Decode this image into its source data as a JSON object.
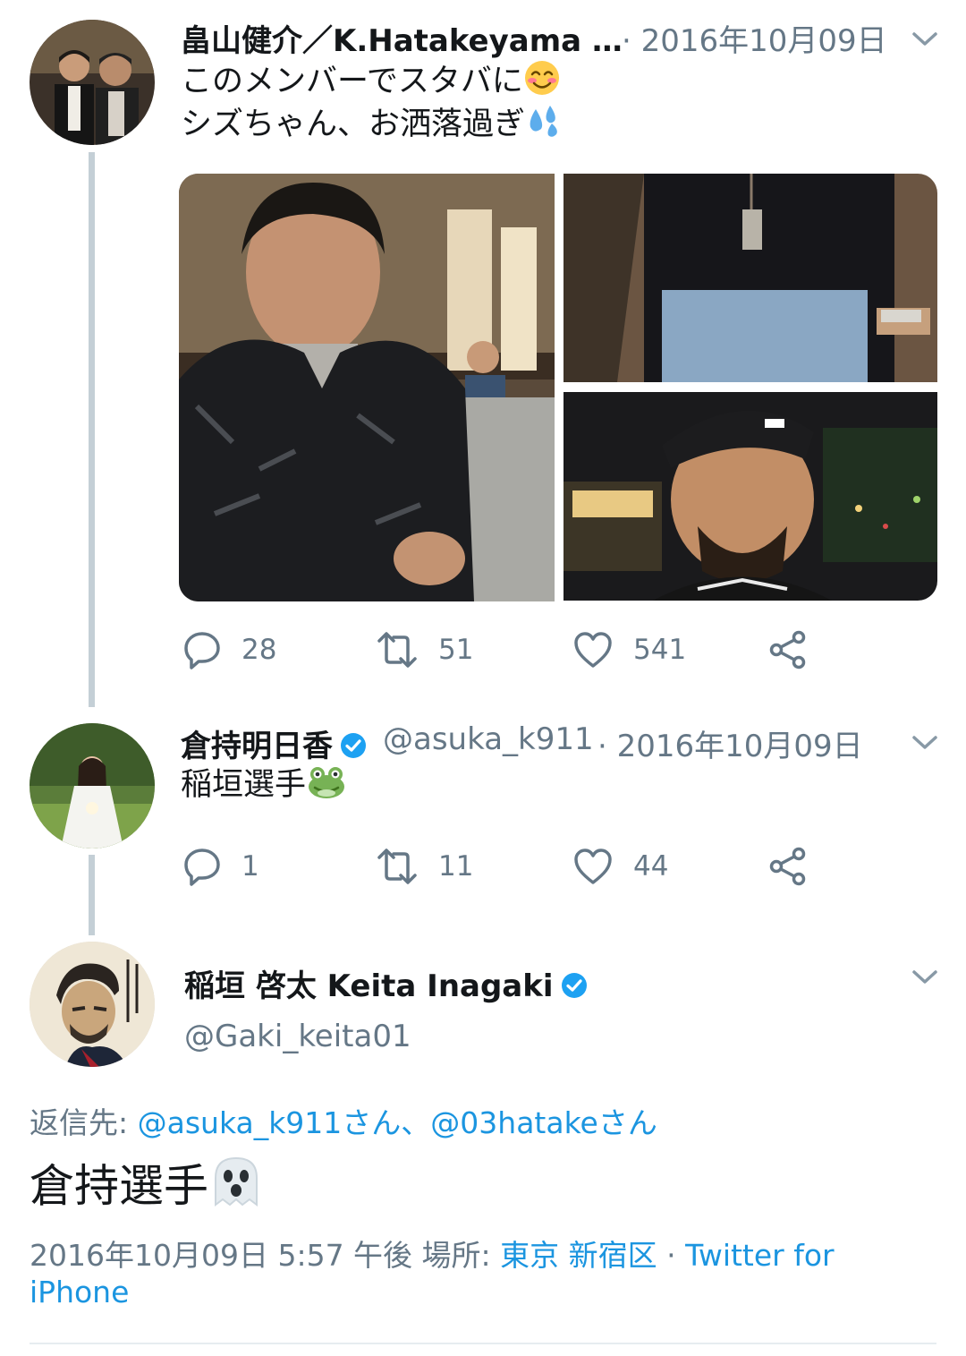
{
  "tweet1": {
    "display_name": "畠山健介／K.Hatakeyama …",
    "date": "· 2016年10月09日",
    "line1": "このメンバーでスタバに",
    "line2": "シズちゃん、お洒落過ぎ",
    "emoji1": "smiling-face-emoji",
    "emoji2": "sweat-droplets-emoji",
    "replies": "28",
    "retweets": "51",
    "likes": "541"
  },
  "tweet2": {
    "display_name": "倉持明日香",
    "handle": "@asuka_k911",
    "date": "· 2016年10月09日",
    "text": "稲垣選手",
    "emoji": "frog-emoji",
    "replies": "1",
    "retweets": "11",
    "likes": "44"
  },
  "tweet3": {
    "display_name": "稲垣 啓太 Keita Inagaki",
    "handle": "@Gaki_keita01",
    "reply_prefix": "返信先: ",
    "reply_to_1": "@asuka_k911さん",
    "reply_sep": "、",
    "reply_to_2": "@03hatakeさん",
    "text": "倉持選手",
    "emoji": "ghost-emoji",
    "timestamp": "2016年10月09日 5:57 午後 場所: ",
    "location": "東京 新宿区",
    "source_sep": " · ",
    "source_line1": "Twitter for",
    "source_line2": "iPhone"
  },
  "colors": {
    "link": "#1b95e0",
    "muted": "#657786",
    "verified": "#1da1f2",
    "thread_line": "#c4cfd6"
  }
}
